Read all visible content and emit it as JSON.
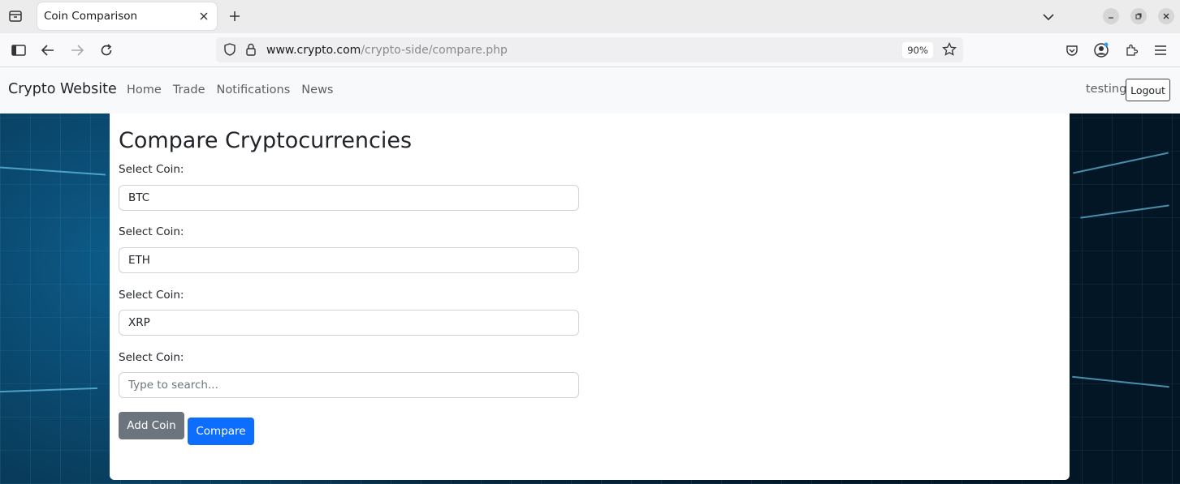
{
  "browser": {
    "tab_title": "Coin Comparison",
    "url_host": "www.crypto.com",
    "url_path": "/crypto-side/compare.php",
    "zoom": "90%"
  },
  "nav": {
    "brand": "Crypto Website",
    "links": [
      "Home",
      "Trade",
      "Notifications",
      "News"
    ],
    "username": "testing",
    "logout": "Logout"
  },
  "page": {
    "title": "Compare Cryptocurrencies",
    "label": "Select Coin:",
    "coins": [
      "BTC",
      "ETH",
      "XRP",
      ""
    ],
    "search_placeholder": "Type to search...",
    "add_coin": "Add Coin",
    "compare": "Compare"
  },
  "colors": {
    "primary": "#0d6efd",
    "secondary": "#6c757d"
  }
}
